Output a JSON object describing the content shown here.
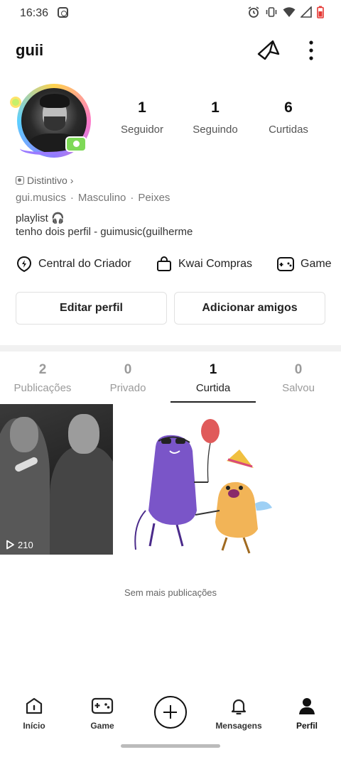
{
  "status_bar": {
    "time": "16:36",
    "icons": [
      "instagram-icon",
      "alarm-icon",
      "vibrate-icon",
      "wifi-icon",
      "signal-icon",
      "battery-icon"
    ],
    "battery_color": "#e53935"
  },
  "header": {
    "username": "guii",
    "actions": [
      "share-icon",
      "more-icon"
    ]
  },
  "stats": [
    {
      "value": "1",
      "label": "Seguidor"
    },
    {
      "value": "1",
      "label": "Seguindo"
    },
    {
      "value": "6",
      "label": "Curtidas"
    }
  ],
  "profile": {
    "badge_label": "Distintivo",
    "badge_chevron": "›",
    "handle": "gui.musics",
    "gender": "Masculino",
    "sign": "Peixes",
    "bio_line1": "playlist 🎧",
    "bio_line2": "tenho dois perfil - guimusic(guilherme"
  },
  "shortcuts": [
    {
      "label": "Central do Criador",
      "icon": "lightning-icon"
    },
    {
      "label": "Kwai Compras",
      "icon": "shopping-bag-icon"
    },
    {
      "label": "Game",
      "icon": "gamepad-icon"
    }
  ],
  "buttons": {
    "edit_profile": "Editar perfil",
    "add_friends": "Adicionar amigos"
  },
  "tabs": [
    {
      "count": "2",
      "label": "Publicações"
    },
    {
      "count": "0",
      "label": "Privado"
    },
    {
      "count": "1",
      "label": "Curtida"
    },
    {
      "count": "0",
      "label": "Salvou"
    }
  ],
  "active_tab": "Curtida",
  "posts": [
    {
      "views": "210",
      "icon": "play-icon"
    }
  ],
  "end_text": "Sem mais publicações",
  "bottom_nav": [
    {
      "label": "Início",
      "icon": "home-icon"
    },
    {
      "label": "Game",
      "icon": "gamepad-icon"
    },
    {
      "label": "",
      "icon": "create-plus-icon"
    },
    {
      "label": "Mensagens",
      "icon": "bell-icon"
    },
    {
      "label": "Perfil",
      "icon": "profile-icon"
    }
  ],
  "colors": {
    "text": "#222222",
    "muted": "#9a9a9a",
    "divider": "#f1f1f1"
  }
}
